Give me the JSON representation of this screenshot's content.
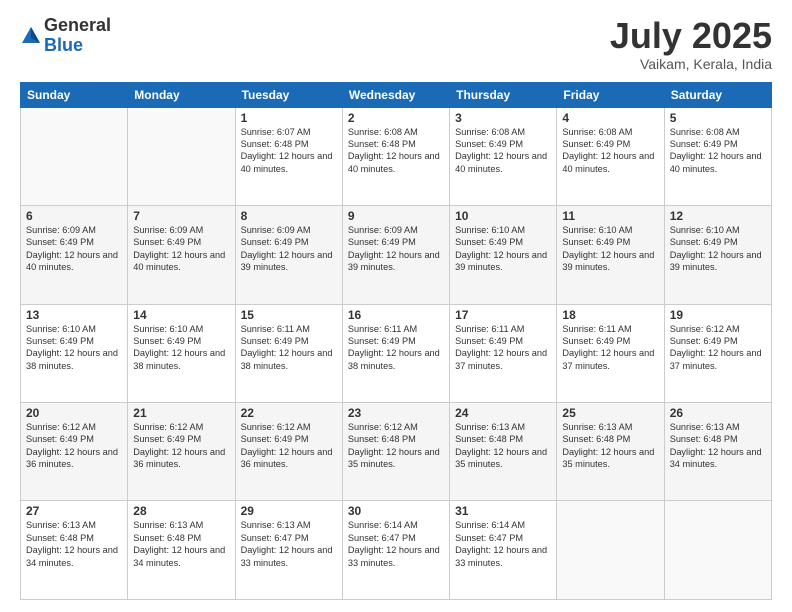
{
  "logo": {
    "general": "General",
    "blue": "Blue"
  },
  "title": "July 2025",
  "location": "Vaikam, Kerala, India",
  "days_of_week": [
    "Sunday",
    "Monday",
    "Tuesday",
    "Wednesday",
    "Thursday",
    "Friday",
    "Saturday"
  ],
  "weeks": [
    [
      {
        "day": "",
        "info": ""
      },
      {
        "day": "",
        "info": ""
      },
      {
        "day": "1",
        "info": "Sunrise: 6:07 AM\nSunset: 6:48 PM\nDaylight: 12 hours and 40 minutes."
      },
      {
        "day": "2",
        "info": "Sunrise: 6:08 AM\nSunset: 6:48 PM\nDaylight: 12 hours and 40 minutes."
      },
      {
        "day": "3",
        "info": "Sunrise: 6:08 AM\nSunset: 6:49 PM\nDaylight: 12 hours and 40 minutes."
      },
      {
        "day": "4",
        "info": "Sunrise: 6:08 AM\nSunset: 6:49 PM\nDaylight: 12 hours and 40 minutes."
      },
      {
        "day": "5",
        "info": "Sunrise: 6:08 AM\nSunset: 6:49 PM\nDaylight: 12 hours and 40 minutes."
      }
    ],
    [
      {
        "day": "6",
        "info": "Sunrise: 6:09 AM\nSunset: 6:49 PM\nDaylight: 12 hours and 40 minutes."
      },
      {
        "day": "7",
        "info": "Sunrise: 6:09 AM\nSunset: 6:49 PM\nDaylight: 12 hours and 40 minutes."
      },
      {
        "day": "8",
        "info": "Sunrise: 6:09 AM\nSunset: 6:49 PM\nDaylight: 12 hours and 39 minutes."
      },
      {
        "day": "9",
        "info": "Sunrise: 6:09 AM\nSunset: 6:49 PM\nDaylight: 12 hours and 39 minutes."
      },
      {
        "day": "10",
        "info": "Sunrise: 6:10 AM\nSunset: 6:49 PM\nDaylight: 12 hours and 39 minutes."
      },
      {
        "day": "11",
        "info": "Sunrise: 6:10 AM\nSunset: 6:49 PM\nDaylight: 12 hours and 39 minutes."
      },
      {
        "day": "12",
        "info": "Sunrise: 6:10 AM\nSunset: 6:49 PM\nDaylight: 12 hours and 39 minutes."
      }
    ],
    [
      {
        "day": "13",
        "info": "Sunrise: 6:10 AM\nSunset: 6:49 PM\nDaylight: 12 hours and 38 minutes."
      },
      {
        "day": "14",
        "info": "Sunrise: 6:10 AM\nSunset: 6:49 PM\nDaylight: 12 hours and 38 minutes."
      },
      {
        "day": "15",
        "info": "Sunrise: 6:11 AM\nSunset: 6:49 PM\nDaylight: 12 hours and 38 minutes."
      },
      {
        "day": "16",
        "info": "Sunrise: 6:11 AM\nSunset: 6:49 PM\nDaylight: 12 hours and 38 minutes."
      },
      {
        "day": "17",
        "info": "Sunrise: 6:11 AM\nSunset: 6:49 PM\nDaylight: 12 hours and 37 minutes."
      },
      {
        "day": "18",
        "info": "Sunrise: 6:11 AM\nSunset: 6:49 PM\nDaylight: 12 hours and 37 minutes."
      },
      {
        "day": "19",
        "info": "Sunrise: 6:12 AM\nSunset: 6:49 PM\nDaylight: 12 hours and 37 minutes."
      }
    ],
    [
      {
        "day": "20",
        "info": "Sunrise: 6:12 AM\nSunset: 6:49 PM\nDaylight: 12 hours and 36 minutes."
      },
      {
        "day": "21",
        "info": "Sunrise: 6:12 AM\nSunset: 6:49 PM\nDaylight: 12 hours and 36 minutes."
      },
      {
        "day": "22",
        "info": "Sunrise: 6:12 AM\nSunset: 6:49 PM\nDaylight: 12 hours and 36 minutes."
      },
      {
        "day": "23",
        "info": "Sunrise: 6:12 AM\nSunset: 6:48 PM\nDaylight: 12 hours and 35 minutes."
      },
      {
        "day": "24",
        "info": "Sunrise: 6:13 AM\nSunset: 6:48 PM\nDaylight: 12 hours and 35 minutes."
      },
      {
        "day": "25",
        "info": "Sunrise: 6:13 AM\nSunset: 6:48 PM\nDaylight: 12 hours and 35 minutes."
      },
      {
        "day": "26",
        "info": "Sunrise: 6:13 AM\nSunset: 6:48 PM\nDaylight: 12 hours and 34 minutes."
      }
    ],
    [
      {
        "day": "27",
        "info": "Sunrise: 6:13 AM\nSunset: 6:48 PM\nDaylight: 12 hours and 34 minutes."
      },
      {
        "day": "28",
        "info": "Sunrise: 6:13 AM\nSunset: 6:48 PM\nDaylight: 12 hours and 34 minutes."
      },
      {
        "day": "29",
        "info": "Sunrise: 6:13 AM\nSunset: 6:47 PM\nDaylight: 12 hours and 33 minutes."
      },
      {
        "day": "30",
        "info": "Sunrise: 6:14 AM\nSunset: 6:47 PM\nDaylight: 12 hours and 33 minutes."
      },
      {
        "day": "31",
        "info": "Sunrise: 6:14 AM\nSunset: 6:47 PM\nDaylight: 12 hours and 33 minutes."
      },
      {
        "day": "",
        "info": ""
      },
      {
        "day": "",
        "info": ""
      }
    ]
  ]
}
